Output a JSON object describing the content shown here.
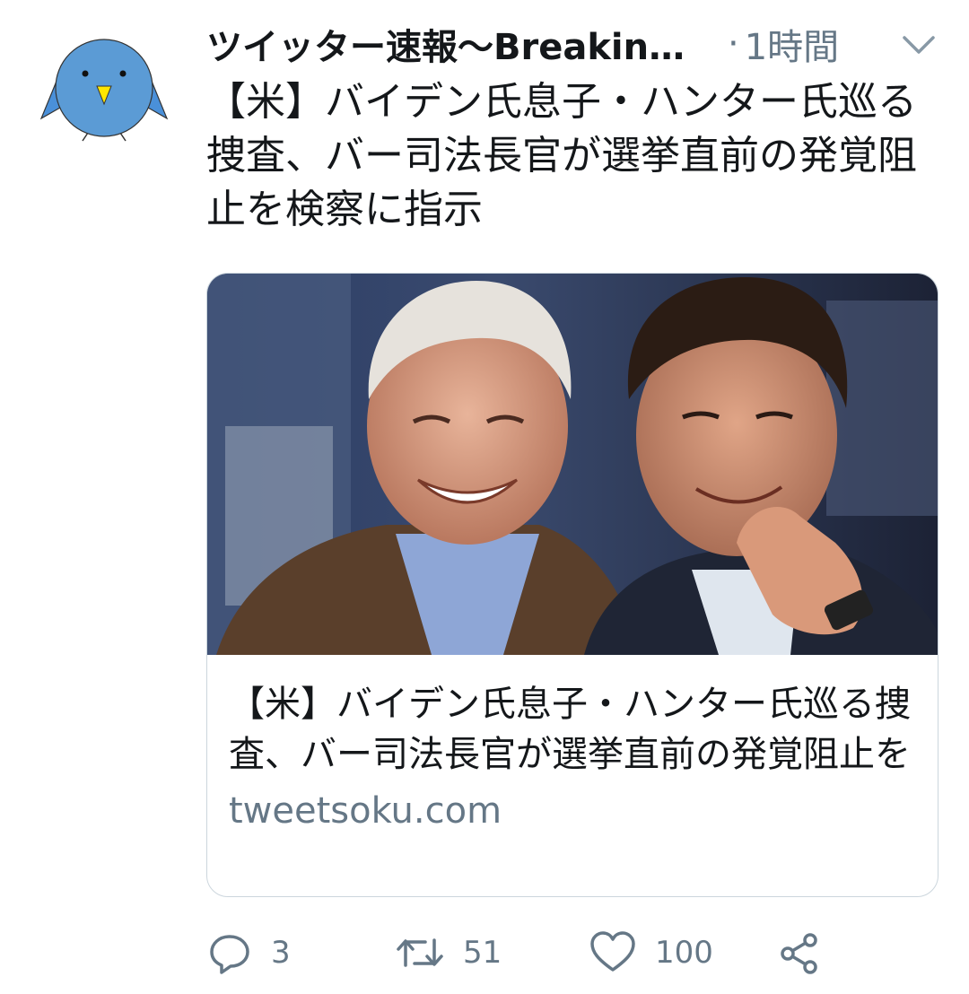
{
  "tweet": {
    "author": "ツイッター速報〜BreakingNews",
    "separator": "·",
    "time": "1時間",
    "text": "【米】バイデン氏息子・ハンター氏巡る捜査、バー司法長官が選挙直前の発覚阻止を検察に指示"
  },
  "card": {
    "title": "【米】バイデン氏息子・ハンター氏巡る捜査、バー司法長官が選挙直前の発覚阻止を検察に指示",
    "domain": "tweetsoku.com"
  },
  "actions": {
    "reply_count": "3",
    "retweet_count": "51",
    "like_count": "100"
  },
  "icons": {
    "avatar": "blue-bird-avatar",
    "menu": "chevron-down-icon",
    "reply": "reply-icon",
    "retweet": "retweet-icon",
    "like": "heart-icon",
    "share": "share-icon"
  },
  "colors": {
    "text": "#14171a",
    "secondary": "#657786",
    "border": "#ccd6dd",
    "avatar_bird": "#4a90d9",
    "beak": "#ffe600"
  }
}
